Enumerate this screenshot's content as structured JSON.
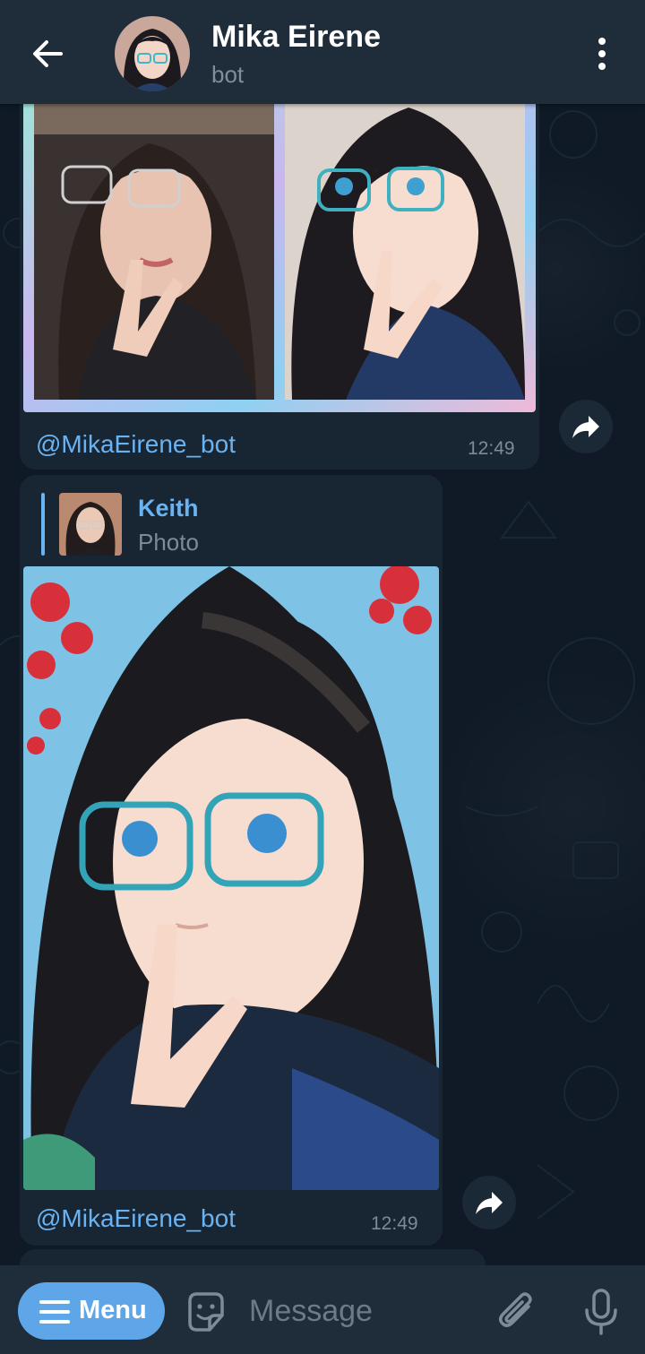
{
  "header": {
    "title": "Mika Eirene",
    "subtitle": "bot",
    "back_icon": "arrow-left-icon",
    "more_icon": "vertical-dots-icon"
  },
  "messages": [
    {
      "type": "photo",
      "caption": "@MikaEirene_bot",
      "time": "12:49",
      "share_icon": "share-arrow-icon"
    },
    {
      "type": "photo",
      "reply": {
        "name": "Keith",
        "text": "Photo"
      },
      "caption": "@MikaEirene_bot",
      "time": "12:49",
      "share_icon": "share-arrow-icon"
    }
  ],
  "input_bar": {
    "menu_label": "Menu",
    "placeholder": "Message",
    "sticker_icon": "sticker-icon",
    "attach_icon": "paperclip-icon",
    "mic_icon": "microphone-icon"
  },
  "colors": {
    "accent": "#6ab3f3",
    "menu_button": "#5fa6e8",
    "header": "#1f2c3a",
    "bubble": "#182533",
    "background": "#0f1a26"
  }
}
